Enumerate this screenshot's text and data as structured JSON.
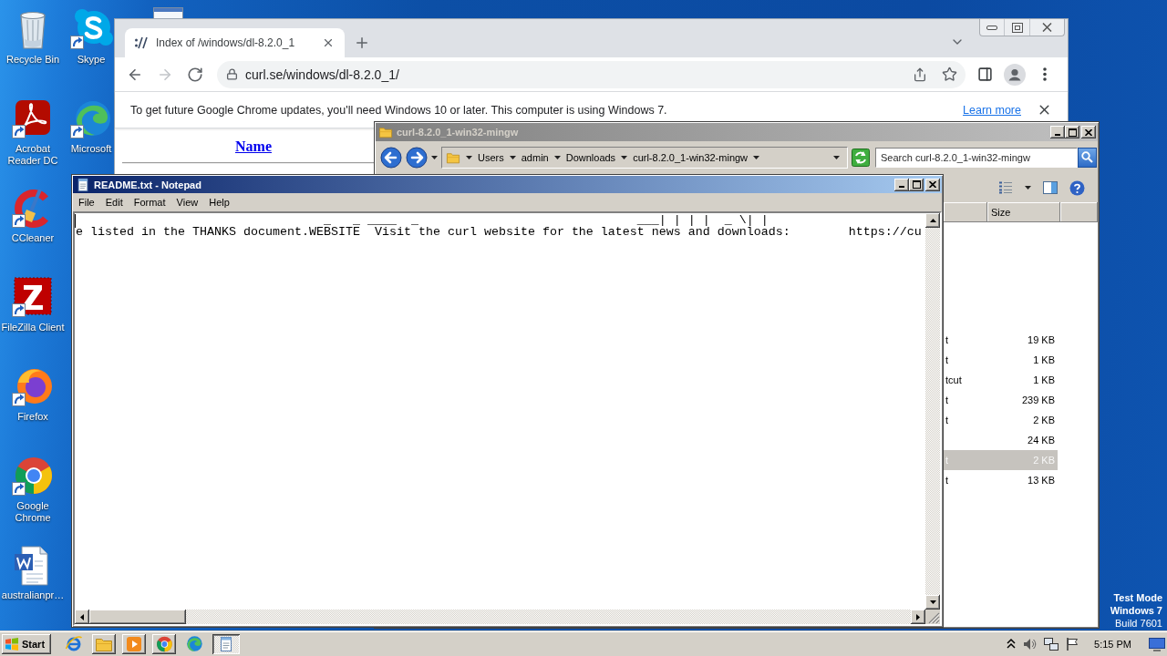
{
  "desktop": {
    "icons": [
      {
        "label": "Recycle Bin",
        "kind": "bin",
        "shortcut": false
      },
      {
        "label": "Acrobat Reader DC",
        "kind": "acrobat",
        "shortcut": true
      },
      {
        "label": "CCleaner",
        "kind": "ccleaner",
        "shortcut": true
      },
      {
        "label": "FileZilla Client",
        "kind": "filezilla",
        "shortcut": true
      },
      {
        "label": "Firefox",
        "kind": "firefox",
        "shortcut": true
      },
      {
        "label": "Google Chrome",
        "kind": "chrome",
        "shortcut": true
      },
      {
        "label": "australianpr…",
        "kind": "word",
        "shortcut": false
      },
      {
        "label": "Skype",
        "kind": "skype",
        "shortcut": true
      },
      {
        "label": "Microsoft",
        "kind": "edge",
        "shortcut": true
      }
    ],
    "test_mode_notice": {
      "lines": [
        "Test Mode",
        "Windows 7"
      ],
      "build": "Build 7601"
    }
  },
  "browser": {
    "tabs": [
      {
        "title": "Index of /windows/dl-8.2.0_1",
        "selected": true
      }
    ],
    "nav": [
      {
        "kind": "back",
        "disabled": false
      },
      {
        "kind": "forward",
        "disabled": true
      },
      {
        "kind": "reload",
        "disabled": false
      }
    ],
    "url": "curl.se/windows/dl-8.2.0_1/",
    "infobar": {
      "message": "To get future Google Chrome updates, you'll need Windows 10 or later. This computer is using Windows 7.",
      "link": "Learn more"
    },
    "page": {
      "column_header": "Name"
    }
  },
  "explorer": {
    "title": "curl-8.2.0_1-win32-mingw",
    "active": false,
    "breadcrumb": [
      "Users",
      "admin",
      "Downloads",
      "curl-8.2.0_1-win32-mingw"
    ],
    "search": {
      "placeholder": "Search curl-8.2.0_1-win32-mingw"
    },
    "columns": [
      "Size"
    ],
    "rows": [
      {
        "column_1": "t",
        "size": "19 KB",
        "selected": false
      },
      {
        "column_1": "t",
        "size": "1 KB",
        "selected": false
      },
      {
        "column_1": "tcut",
        "size": "1 KB",
        "selected": false
      },
      {
        "column_1": "t",
        "size": "239 KB",
        "selected": false
      },
      {
        "column_1": "t",
        "size": "2 KB",
        "selected": false
      },
      {
        "size": "24 KB",
        "selected": false
      },
      {
        "column_1": "t",
        "size": "2 KB",
        "selected": true
      },
      {
        "column_1": "t",
        "size": "13 KB",
        "selected": false
      }
    ]
  },
  "notepad": {
    "title": "README.txt - Notepad",
    "active": true,
    "menu": [
      "File",
      "Edit",
      "Format",
      "View",
      "Help"
    ],
    "lines": [
      "                                  _   _ ____  _                              ___| | | |  _ \\| |",
      "e listed in the THANKS document.WEBSITE  Visit the curl website for the latest news and downloads:        https://cu"
    ]
  },
  "taskbar": {
    "start": "Start",
    "apps": [
      {
        "kind": "ie",
        "running": false,
        "active": false
      },
      {
        "kind": "explorer",
        "running": true,
        "active": false
      },
      {
        "kind": "media",
        "running": true,
        "active": false
      },
      {
        "kind": "chrome",
        "running": true,
        "active": false
      },
      {
        "kind": "edge",
        "running": false,
        "active": false
      },
      {
        "kind": "notepad",
        "running": true,
        "active": true
      }
    ],
    "clock": "5:15 PM"
  }
}
